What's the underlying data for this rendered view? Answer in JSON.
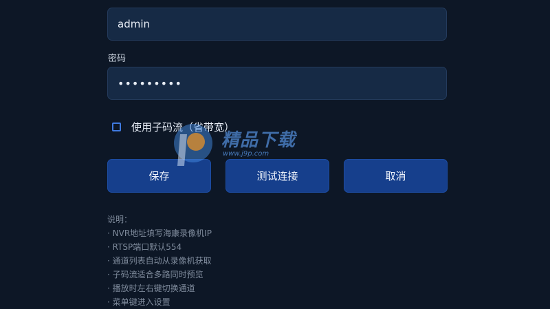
{
  "form": {
    "username_value": "admin",
    "password_label": "密码",
    "password_value": "•••••••••",
    "substream_checkbox": {
      "label": "使用子码流（省带宽）",
      "checked": false
    }
  },
  "buttons": {
    "save": "保存",
    "test_connection": "测试连接",
    "cancel": "取消"
  },
  "notes": {
    "title": "说明：",
    "items": [
      "· NVR地址填写海康录像机IP",
      "· RTSP端口默认554",
      "· 通道列表自动从录像机获取",
      "· 子码流适合多路同时预览",
      "· 播放时左右键切换通道",
      "· 菜单键进入设置"
    ]
  },
  "watermark": {
    "brand_text": "精品下载",
    "url": "www.j9p.com"
  },
  "colors": {
    "background": "#0d1726",
    "field_bg": "#162a45",
    "button_bg": "#163f8c",
    "checkbox_border": "#3f7ae0",
    "note_text": "#7f8b9c"
  }
}
